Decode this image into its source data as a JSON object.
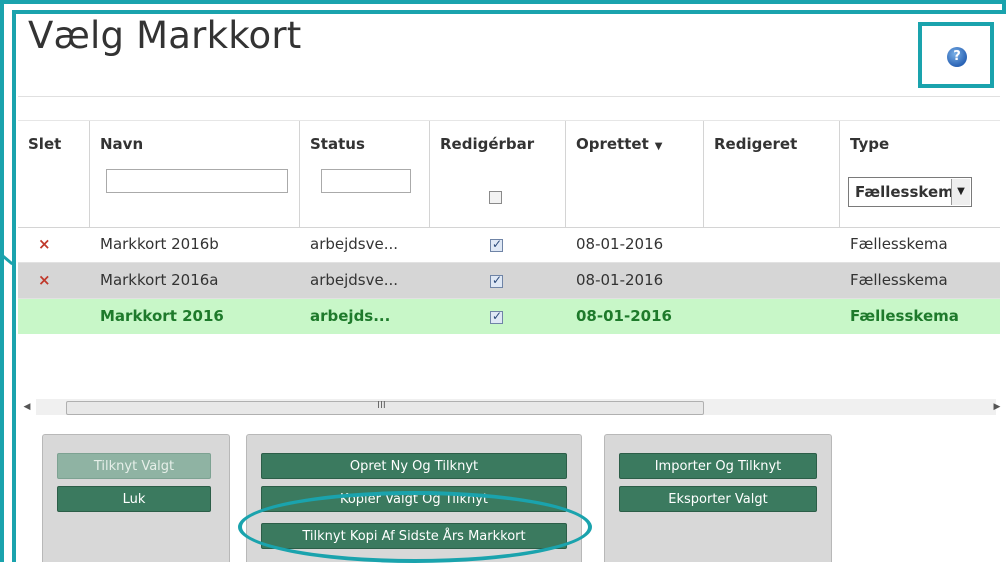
{
  "title": "Vælg Markkort",
  "help_icon_glyph": "?",
  "columns": {
    "slet": "Slet",
    "navn": "Navn",
    "status": "Status",
    "redigerbar": "Redigérbar",
    "oprettet": "Oprettet",
    "redigeret": "Redigeret",
    "type": "Type"
  },
  "filters": {
    "navn": "",
    "status": "",
    "type": "Fællesskem"
  },
  "rows": [
    {
      "slet": "×",
      "navn": "Markkort 2016b",
      "status": "arbejdsve...",
      "redigerbar": true,
      "oprettet": "08-01-2016",
      "redigeret": "",
      "type": "Fællesskema"
    },
    {
      "slet": "×",
      "navn": "Markkort 2016a",
      "status": "arbejdsve...",
      "redigerbar": true,
      "oprettet": "08-01-2016",
      "redigeret": "",
      "type": "Fællesskema"
    },
    {
      "slet": "",
      "navn": "Markkort 2016",
      "status": "arbejds...",
      "redigerbar": true,
      "oprettet": "08-01-2016",
      "redigeret": "",
      "type": "Fællesskema"
    }
  ],
  "scrollbar_grip": "III",
  "buttons": {
    "tilknyt_valgt": "Tilknyt Valgt",
    "luk": "Luk",
    "opret_ny": "Opret Ny Og Tilknyt",
    "kopier_valgt": "Kopier Valgt Og Tilknyt",
    "tilknyt_kopi": "Tilknyt Kopi Af Sidste Års Markkort",
    "importer": "Importer Og Tilknyt",
    "eksporter": "Eksporter Valgt"
  },
  "colors": {
    "highlight": "#1aa3ad",
    "button": "#3b7a5f",
    "selected_row": "#c8f7c8",
    "selected_text": "#1e7a2b",
    "delete": "#c0392b"
  }
}
